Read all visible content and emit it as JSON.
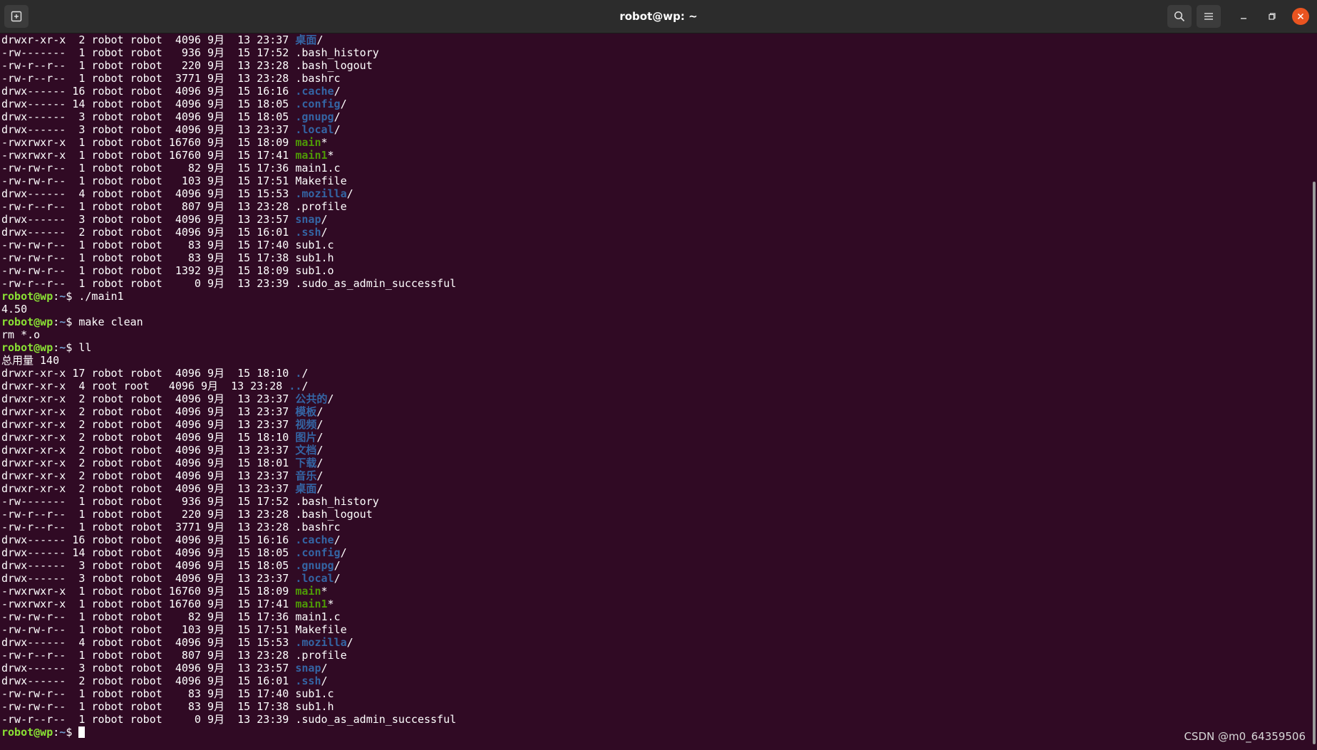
{
  "window": {
    "title": "robot@wp: ~",
    "icons": {
      "new_tab": "new-tab-icon",
      "search": "search-icon",
      "menu": "hamburger-menu-icon",
      "minimize": "minimize-icon",
      "maximize": "maximize-icon",
      "close": "close-icon"
    },
    "colors": {
      "background": "#300a24",
      "prompt": "#8ae234",
      "directory": "#3465a4",
      "executable": "#4e9a06",
      "close_button": "#e95420"
    }
  },
  "terminal": {
    "lines": [
      {
        "perm": "drwxr-xr-x",
        "links": " 2",
        "user": "robot",
        "group": "robot",
        "size": " 4096",
        "month": "9月",
        "day": "13",
        "time": "23:37",
        "name": "桌面",
        "suffix": "/",
        "kind": "dir"
      },
      {
        "perm": "-rw-------",
        "links": " 1",
        "user": "robot",
        "group": "robot",
        "size": "  936",
        "month": "9月",
        "day": "15",
        "time": "17:52",
        "name": ".bash_history",
        "suffix": "",
        "kind": "file"
      },
      {
        "perm": "-rw-r--r--",
        "links": " 1",
        "user": "robot",
        "group": "robot",
        "size": "  220",
        "month": "9月",
        "day": "13",
        "time": "23:28",
        "name": ".bash_logout",
        "suffix": "",
        "kind": "file"
      },
      {
        "perm": "-rw-r--r--",
        "links": " 1",
        "user": "robot",
        "group": "robot",
        "size": " 3771",
        "month": "9月",
        "day": "13",
        "time": "23:28",
        "name": ".bashrc",
        "suffix": "",
        "kind": "file"
      },
      {
        "perm": "drwx------",
        "links": "16",
        "user": "robot",
        "group": "robot",
        "size": " 4096",
        "month": "9月",
        "day": "15",
        "time": "16:16",
        "name": ".cache",
        "suffix": "/",
        "kind": "dir"
      },
      {
        "perm": "drwx------",
        "links": "14",
        "user": "robot",
        "group": "robot",
        "size": " 4096",
        "month": "9月",
        "day": "15",
        "time": "18:05",
        "name": ".config",
        "suffix": "/",
        "kind": "dir"
      },
      {
        "perm": "drwx------",
        "links": " 3",
        "user": "robot",
        "group": "robot",
        "size": " 4096",
        "month": "9月",
        "day": "15",
        "time": "18:05",
        "name": ".gnupg",
        "suffix": "/",
        "kind": "dir"
      },
      {
        "perm": "drwx------",
        "links": " 3",
        "user": "robot",
        "group": "robot",
        "size": " 4096",
        "month": "9月",
        "day": "13",
        "time": "23:37",
        "name": ".local",
        "suffix": "/",
        "kind": "dir"
      },
      {
        "perm": "-rwxrwxr-x",
        "links": " 1",
        "user": "robot",
        "group": "robot",
        "size": "16760",
        "month": "9月",
        "day": "15",
        "time": "18:09",
        "name": "main",
        "suffix": "*",
        "kind": "exec"
      },
      {
        "perm": "-rwxrwxr-x",
        "links": " 1",
        "user": "robot",
        "group": "robot",
        "size": "16760",
        "month": "9月",
        "day": "15",
        "time": "17:41",
        "name": "main1",
        "suffix": "*",
        "kind": "exec"
      },
      {
        "perm": "-rw-rw-r--",
        "links": " 1",
        "user": "robot",
        "group": "robot",
        "size": "   82",
        "month": "9月",
        "day": "15",
        "time": "17:36",
        "name": "main1.c",
        "suffix": "",
        "kind": "file"
      },
      {
        "perm": "-rw-rw-r--",
        "links": " 1",
        "user": "robot",
        "group": "robot",
        "size": "  103",
        "month": "9月",
        "day": "15",
        "time": "17:51",
        "name": "Makefile",
        "suffix": "",
        "kind": "file"
      },
      {
        "perm": "drwx------",
        "links": " 4",
        "user": "robot",
        "group": "robot",
        "size": " 4096",
        "month": "9月",
        "day": "15",
        "time": "15:53",
        "name": ".mozilla",
        "suffix": "/",
        "kind": "dir"
      },
      {
        "perm": "-rw-r--r--",
        "links": " 1",
        "user": "robot",
        "group": "robot",
        "size": "  807",
        "month": "9月",
        "day": "13",
        "time": "23:28",
        "name": ".profile",
        "suffix": "",
        "kind": "file"
      },
      {
        "perm": "drwx------",
        "links": " 3",
        "user": "robot",
        "group": "robot",
        "size": " 4096",
        "month": "9月",
        "day": "13",
        "time": "23:57",
        "name": "snap",
        "suffix": "/",
        "kind": "dir"
      },
      {
        "perm": "drwx------",
        "links": " 2",
        "user": "robot",
        "group": "robot",
        "size": " 4096",
        "month": "9月",
        "day": "15",
        "time": "16:01",
        "name": ".ssh",
        "suffix": "/",
        "kind": "dir"
      },
      {
        "perm": "-rw-rw-r--",
        "links": " 1",
        "user": "robot",
        "group": "robot",
        "size": "   83",
        "month": "9月",
        "day": "15",
        "time": "17:40",
        "name": "sub1.c",
        "suffix": "",
        "kind": "file"
      },
      {
        "perm": "-rw-rw-r--",
        "links": " 1",
        "user": "robot",
        "group": "robot",
        "size": "   83",
        "month": "9月",
        "day": "15",
        "time": "17:38",
        "name": "sub1.h",
        "suffix": "",
        "kind": "file"
      },
      {
        "perm": "-rw-rw-r--",
        "links": " 1",
        "user": "robot",
        "group": "robot",
        "size": " 1392",
        "month": "9月",
        "day": "15",
        "time": "18:09",
        "name": "sub1.o",
        "suffix": "",
        "kind": "file"
      },
      {
        "perm": "-rw-r--r--",
        "links": " 1",
        "user": "robot",
        "group": "robot",
        "size": "    0",
        "month": "9月",
        "day": "13",
        "time": "23:39",
        "name": ".sudo_as_admin_successful",
        "suffix": "",
        "kind": "file"
      },
      {
        "kind": "prompt",
        "user_host": "robot@wp",
        "path": "~",
        "cmd": "./main1"
      },
      {
        "kind": "output",
        "text": "4.50"
      },
      {
        "kind": "prompt",
        "user_host": "robot@wp",
        "path": "~",
        "cmd": "make clean"
      },
      {
        "kind": "output",
        "text": "rm *.o"
      },
      {
        "kind": "prompt",
        "user_host": "robot@wp",
        "path": "~",
        "cmd": "ll"
      },
      {
        "kind": "output",
        "text": "总用量 140"
      },
      {
        "perm": "drwxr-xr-x",
        "links": "17",
        "user": "robot",
        "group": "robot",
        "size": " 4096",
        "month": "9月",
        "day": "15",
        "time": "18:10",
        "name": ".",
        "suffix": "/",
        "kind": "dir"
      },
      {
        "perm": "drwxr-xr-x",
        "links": " 4",
        "user": "root",
        "group": "root ",
        "size": " 4096",
        "month": "9月",
        "day": "13",
        "time": "23:28",
        "name": "..",
        "suffix": "/",
        "kind": "dir"
      },
      {
        "perm": "drwxr-xr-x",
        "links": " 2",
        "user": "robot",
        "group": "robot",
        "size": " 4096",
        "month": "9月",
        "day": "13",
        "time": "23:37",
        "name": "公共的",
        "suffix": "/",
        "kind": "dir"
      },
      {
        "perm": "drwxr-xr-x",
        "links": " 2",
        "user": "robot",
        "group": "robot",
        "size": " 4096",
        "month": "9月",
        "day": "13",
        "time": "23:37",
        "name": "模板",
        "suffix": "/",
        "kind": "dir"
      },
      {
        "perm": "drwxr-xr-x",
        "links": " 2",
        "user": "robot",
        "group": "robot",
        "size": " 4096",
        "month": "9月",
        "day": "13",
        "time": "23:37",
        "name": "视频",
        "suffix": "/",
        "kind": "dir"
      },
      {
        "perm": "drwxr-xr-x",
        "links": " 2",
        "user": "robot",
        "group": "robot",
        "size": " 4096",
        "month": "9月",
        "day": "15",
        "time": "18:10",
        "name": "图片",
        "suffix": "/",
        "kind": "dir"
      },
      {
        "perm": "drwxr-xr-x",
        "links": " 2",
        "user": "robot",
        "group": "robot",
        "size": " 4096",
        "month": "9月",
        "day": "13",
        "time": "23:37",
        "name": "文档",
        "suffix": "/",
        "kind": "dir"
      },
      {
        "perm": "drwxr-xr-x",
        "links": " 2",
        "user": "robot",
        "group": "robot",
        "size": " 4096",
        "month": "9月",
        "day": "15",
        "time": "18:01",
        "name": "下载",
        "suffix": "/",
        "kind": "dir"
      },
      {
        "perm": "drwxr-xr-x",
        "links": " 2",
        "user": "robot",
        "group": "robot",
        "size": " 4096",
        "month": "9月",
        "day": "13",
        "time": "23:37",
        "name": "音乐",
        "suffix": "/",
        "kind": "dir"
      },
      {
        "perm": "drwxr-xr-x",
        "links": " 2",
        "user": "robot",
        "group": "robot",
        "size": " 4096",
        "month": "9月",
        "day": "13",
        "time": "23:37",
        "name": "桌面",
        "suffix": "/",
        "kind": "dir"
      },
      {
        "perm": "-rw-------",
        "links": " 1",
        "user": "robot",
        "group": "robot",
        "size": "  936",
        "month": "9月",
        "day": "15",
        "time": "17:52",
        "name": ".bash_history",
        "suffix": "",
        "kind": "file"
      },
      {
        "perm": "-rw-r--r--",
        "links": " 1",
        "user": "robot",
        "group": "robot",
        "size": "  220",
        "month": "9月",
        "day": "13",
        "time": "23:28",
        "name": ".bash_logout",
        "suffix": "",
        "kind": "file"
      },
      {
        "perm": "-rw-r--r--",
        "links": " 1",
        "user": "robot",
        "group": "robot",
        "size": " 3771",
        "month": "9月",
        "day": "13",
        "time": "23:28",
        "name": ".bashrc",
        "suffix": "",
        "kind": "file"
      },
      {
        "perm": "drwx------",
        "links": "16",
        "user": "robot",
        "group": "robot",
        "size": " 4096",
        "month": "9月",
        "day": "15",
        "time": "16:16",
        "name": ".cache",
        "suffix": "/",
        "kind": "dir"
      },
      {
        "perm": "drwx------",
        "links": "14",
        "user": "robot",
        "group": "robot",
        "size": " 4096",
        "month": "9月",
        "day": "15",
        "time": "18:05",
        "name": ".config",
        "suffix": "/",
        "kind": "dir"
      },
      {
        "perm": "drwx------",
        "links": " 3",
        "user": "robot",
        "group": "robot",
        "size": " 4096",
        "month": "9月",
        "day": "15",
        "time": "18:05",
        "name": ".gnupg",
        "suffix": "/",
        "kind": "dir"
      },
      {
        "perm": "drwx------",
        "links": " 3",
        "user": "robot",
        "group": "robot",
        "size": " 4096",
        "month": "9月",
        "day": "13",
        "time": "23:37",
        "name": ".local",
        "suffix": "/",
        "kind": "dir"
      },
      {
        "perm": "-rwxrwxr-x",
        "links": " 1",
        "user": "robot",
        "group": "robot",
        "size": "16760",
        "month": "9月",
        "day": "15",
        "time": "18:09",
        "name": "main",
        "suffix": "*",
        "kind": "exec"
      },
      {
        "perm": "-rwxrwxr-x",
        "links": " 1",
        "user": "robot",
        "group": "robot",
        "size": "16760",
        "month": "9月",
        "day": "15",
        "time": "17:41",
        "name": "main1",
        "suffix": "*",
        "kind": "exec"
      },
      {
        "perm": "-rw-rw-r--",
        "links": " 1",
        "user": "robot",
        "group": "robot",
        "size": "   82",
        "month": "9月",
        "day": "15",
        "time": "17:36",
        "name": "main1.c",
        "suffix": "",
        "kind": "file"
      },
      {
        "perm": "-rw-rw-r--",
        "links": " 1",
        "user": "robot",
        "group": "robot",
        "size": "  103",
        "month": "9月",
        "day": "15",
        "time": "17:51",
        "name": "Makefile",
        "suffix": "",
        "kind": "file"
      },
      {
        "perm": "drwx------",
        "links": " 4",
        "user": "robot",
        "group": "robot",
        "size": " 4096",
        "month": "9月",
        "day": "15",
        "time": "15:53",
        "name": ".mozilla",
        "suffix": "/",
        "kind": "dir"
      },
      {
        "perm": "-rw-r--r--",
        "links": " 1",
        "user": "robot",
        "group": "robot",
        "size": "  807",
        "month": "9月",
        "day": "13",
        "time": "23:28",
        "name": ".profile",
        "suffix": "",
        "kind": "file"
      },
      {
        "perm": "drwx------",
        "links": " 3",
        "user": "robot",
        "group": "robot",
        "size": " 4096",
        "month": "9月",
        "day": "13",
        "time": "23:57",
        "name": "snap",
        "suffix": "/",
        "kind": "dir"
      },
      {
        "perm": "drwx------",
        "links": " 2",
        "user": "robot",
        "group": "robot",
        "size": " 4096",
        "month": "9月",
        "day": "15",
        "time": "16:01",
        "name": ".ssh",
        "suffix": "/",
        "kind": "dir"
      },
      {
        "perm": "-rw-rw-r--",
        "links": " 1",
        "user": "robot",
        "group": "robot",
        "size": "   83",
        "month": "9月",
        "day": "15",
        "time": "17:40",
        "name": "sub1.c",
        "suffix": "",
        "kind": "file"
      },
      {
        "perm": "-rw-rw-r--",
        "links": " 1",
        "user": "robot",
        "group": "robot",
        "size": "   83",
        "month": "9月",
        "day": "15",
        "time": "17:38",
        "name": "sub1.h",
        "suffix": "",
        "kind": "file"
      },
      {
        "perm": "-rw-r--r--",
        "links": " 1",
        "user": "robot",
        "group": "robot",
        "size": "    0",
        "month": "9月",
        "day": "13",
        "time": "23:39",
        "name": ".sudo_as_admin_successful",
        "suffix": "",
        "kind": "file"
      },
      {
        "kind": "prompt",
        "user_host": "robot@wp",
        "path": "~",
        "cmd": "",
        "cursor": true
      }
    ]
  },
  "watermark": "CSDN @m0_64359506"
}
